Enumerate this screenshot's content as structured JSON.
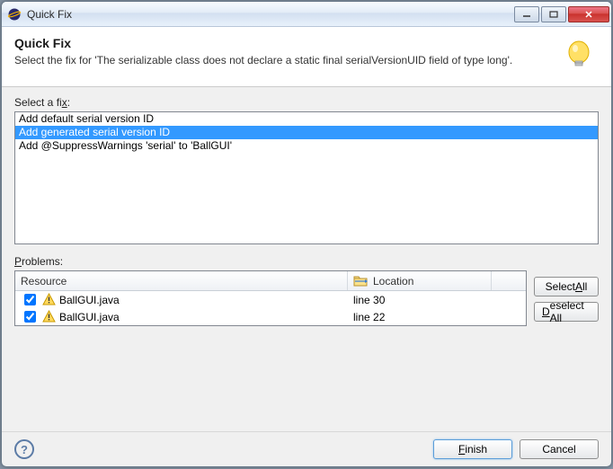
{
  "window": {
    "title": "Quick Fix"
  },
  "header": {
    "heading": "Quick Fix",
    "subtitle": "Select the fix for 'The serializable class  does not declare a static final serialVersionUID field of type long'."
  },
  "fix_section": {
    "label_prefix": "Select a fi",
    "label_accel": "x",
    "label_suffix": ":",
    "items": [
      "Add default serial version ID",
      "Add generated serial version ID",
      "Add @SuppressWarnings 'serial' to 'BallGUI'"
    ],
    "selected_index": 1
  },
  "problems_section": {
    "label_prefix": "",
    "label_accel": "P",
    "label_suffix": "roblems:",
    "columns": {
      "resource": "Resource",
      "location": "Location"
    },
    "rows": [
      {
        "checked": true,
        "filename": "BallGUI.java",
        "location": "line 30"
      },
      {
        "checked": true,
        "filename": "BallGUI.java",
        "location": "line 22"
      }
    ]
  },
  "buttons": {
    "select_all_prefix": "Select ",
    "select_all_accel": "A",
    "select_all_suffix": "ll",
    "deselect_all_prefix": "",
    "deselect_all_accel": "D",
    "deselect_all_suffix": "eselect All",
    "finish_prefix": "",
    "finish_accel": "F",
    "finish_suffix": "inish",
    "cancel": "Cancel"
  }
}
